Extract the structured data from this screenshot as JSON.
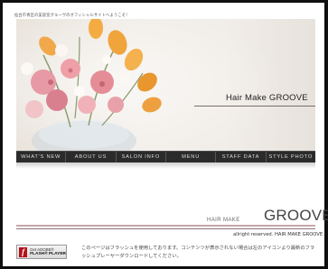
{
  "header": {
    "welcome_text": "仙台市青区の美容室グルーヴのオフィシャルサイトへようこそ！"
  },
  "hero": {
    "title": "Hair Make  GROOVE"
  },
  "nav": {
    "items": [
      {
        "label": "WHAT'S NEW"
      },
      {
        "label": "ABOUT US"
      },
      {
        "label": "SALON INFO"
      },
      {
        "label": "MENU"
      },
      {
        "label": "STAFF DATA"
      },
      {
        "label": "STYLE PHOTO"
      }
    ]
  },
  "brand": {
    "small_text": "HAIR MAKE",
    "large_text": "GROOVE",
    "copyright": "allright reserved. HAIR MAKE GROOVE"
  },
  "flash": {
    "badge_get": "Get ADOBE®",
    "badge_player": "FLASH® PLAYER",
    "note": "このページはフラッシュを使用しております。コンテンツが表示されない場合は左のアイコンより最新のフラッシュプレーヤーダウンロードしてください。"
  },
  "colors": {
    "nav_bg": "#2b2b2b",
    "rule_accent": "#c7a7ab",
    "flash_red": "#b5121b"
  }
}
